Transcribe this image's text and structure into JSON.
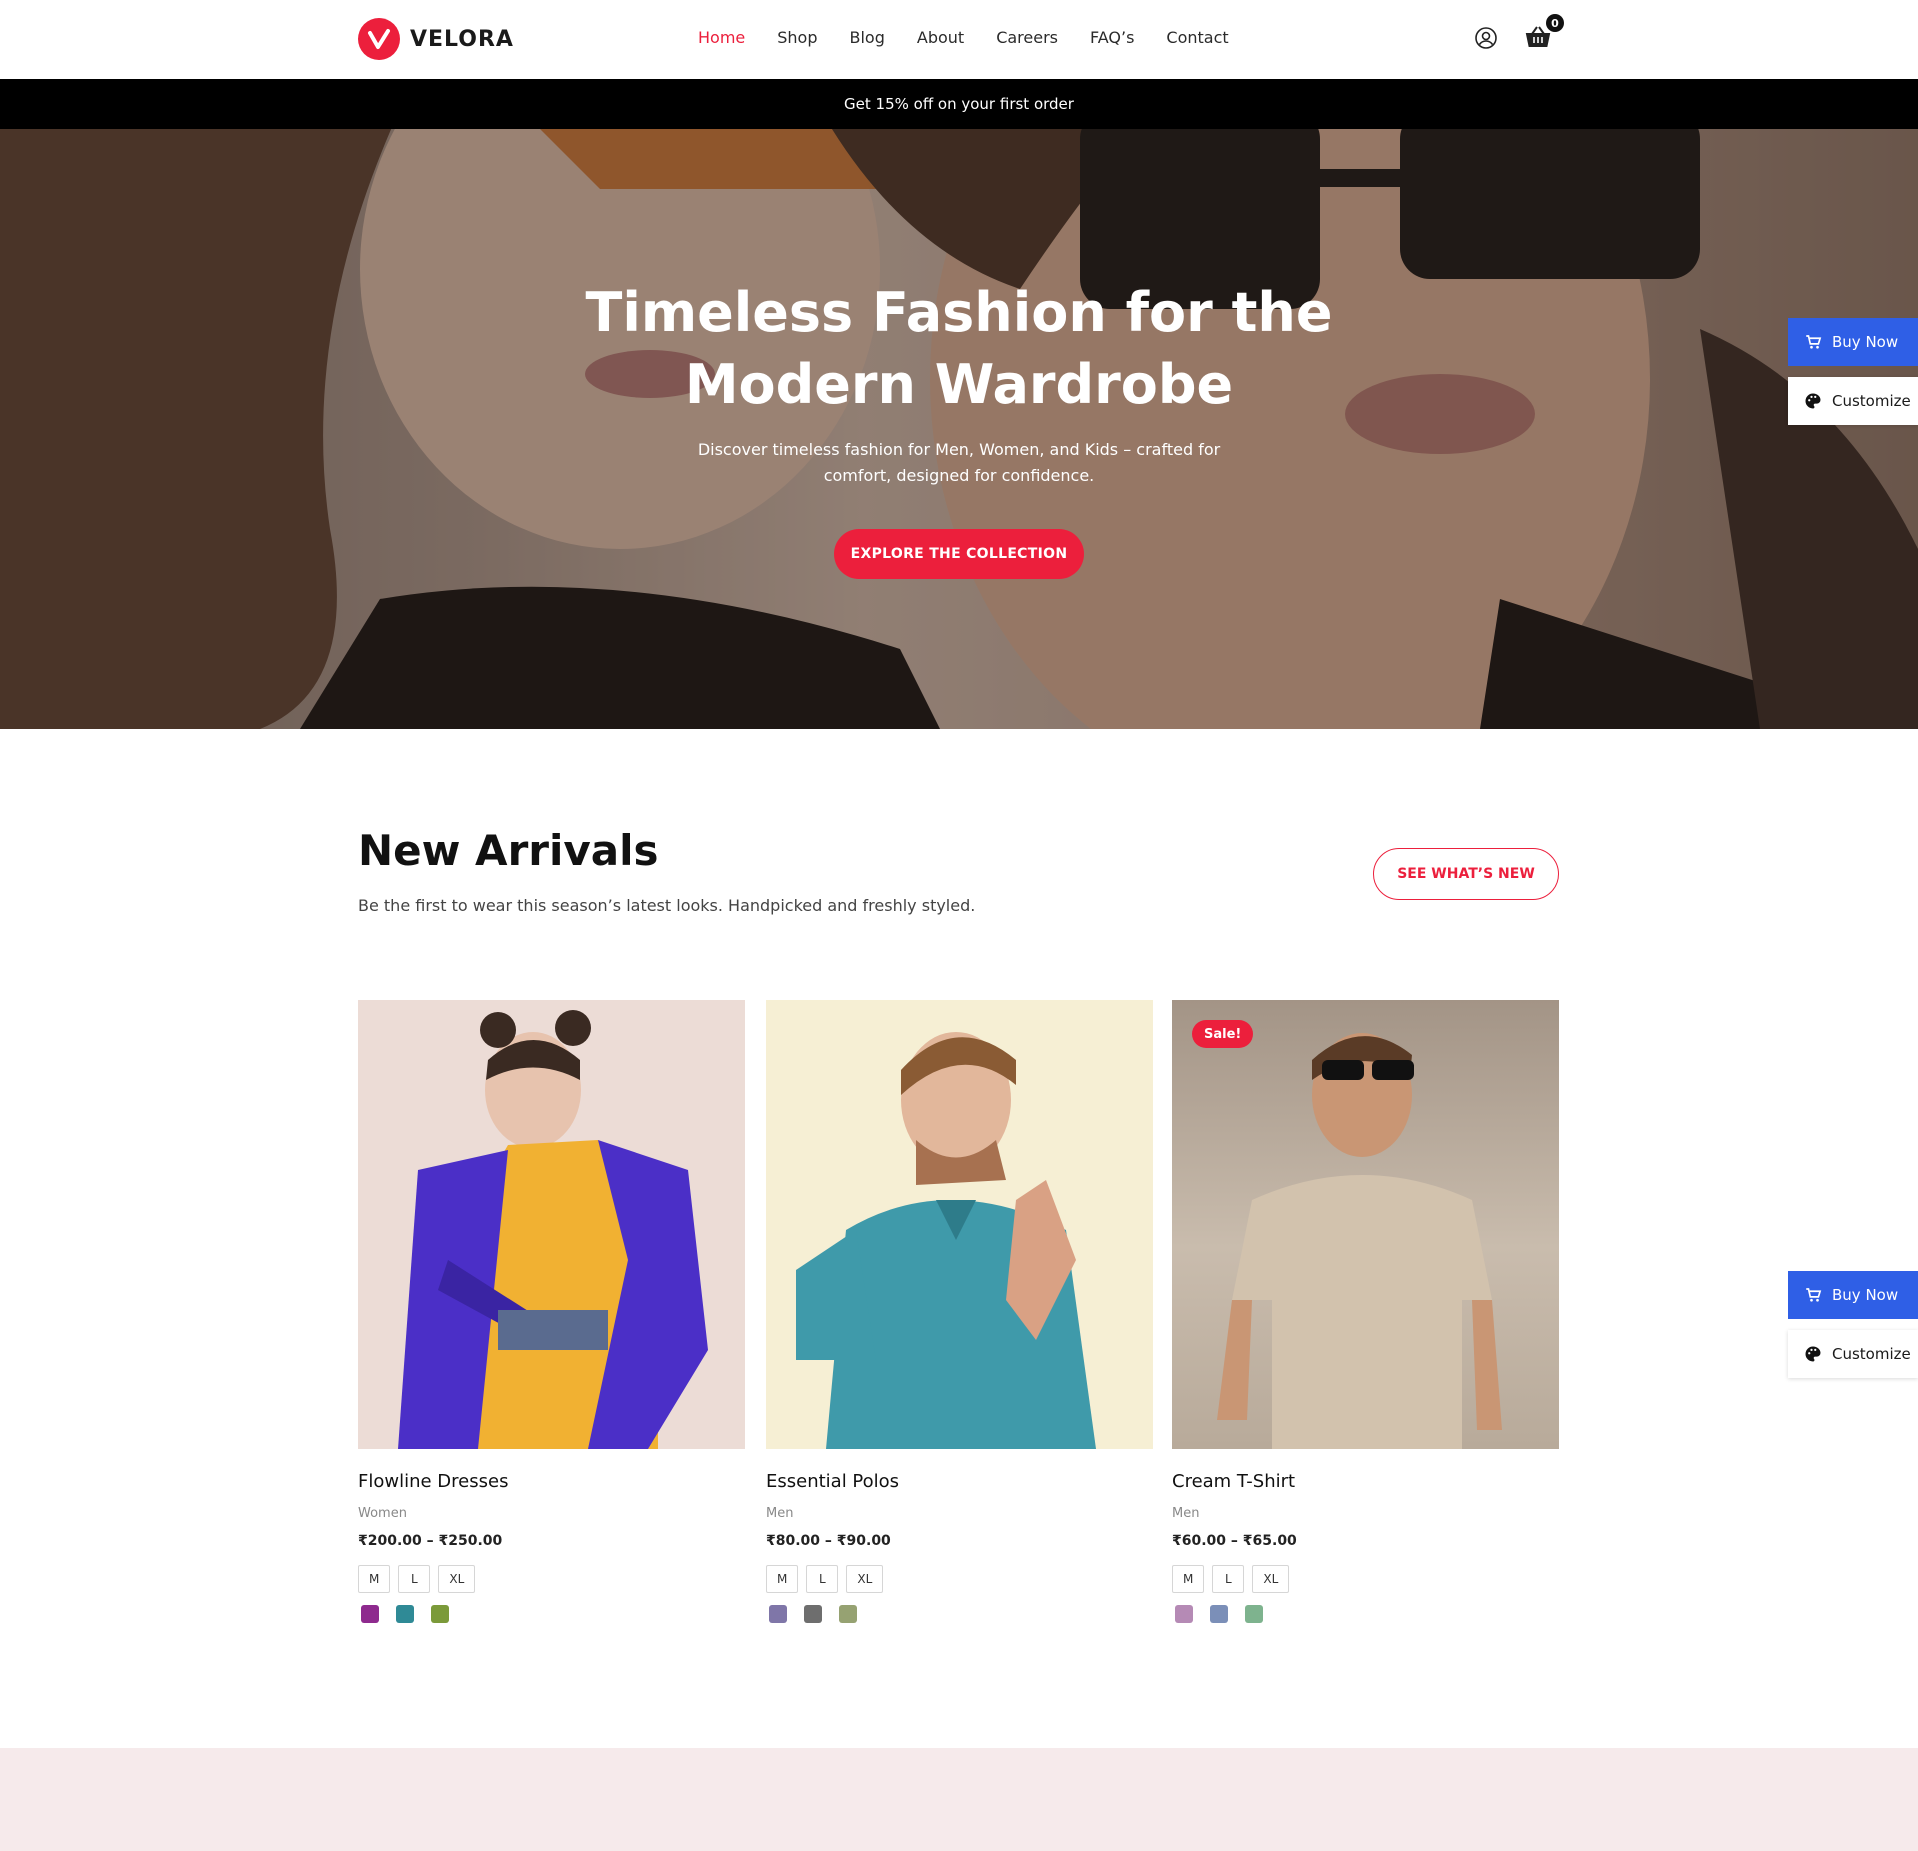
{
  "brand": {
    "name": "VELORA",
    "accent": "#ec1f3c"
  },
  "nav": [
    {
      "label": "Home"
    },
    {
      "label": "Shop"
    },
    {
      "label": "Blog"
    },
    {
      "label": "About"
    },
    {
      "label": "Careers"
    },
    {
      "label": "FAQ’s"
    },
    {
      "label": "Contact"
    }
  ],
  "header": {
    "user_icon": "user-circle-icon",
    "cart_icon": "basket-icon",
    "cart_count": "0"
  },
  "promo": {
    "text": "Get 15% off on your first order"
  },
  "hero": {
    "title_line1": "Timeless Fashion for the",
    "title_line2": "Modern Wardrobe",
    "subtitle_line1": "Discover timeless fashion for Men, Women, and Kids – crafted for",
    "subtitle_line2": "comfort, designed for confidence.",
    "cta": "EXPLORE THE COLLECTION"
  },
  "side_buttons": {
    "buy_now": "Buy Now",
    "customize": "Customize",
    "buy_color": "#2f5fe6"
  },
  "new_arrivals": {
    "title": "New Arrivals",
    "subtitle": "Be the first to wear this season’s latest looks. Handpicked and freshly styled.",
    "button": "SEE WHAT’S NEW"
  },
  "products": [
    {
      "name": "Flowline Dresses",
      "category": "Women",
      "price": "₹200.00 – ₹250.00",
      "sale": "",
      "sizes": [
        "M",
        "L",
        "XL"
      ],
      "colors": [
        "#8e2a8e",
        "#2f8a96",
        "#7b9a3a"
      ]
    },
    {
      "name": "Essential Polos",
      "category": "Men",
      "price": "₹80.00 – ₹90.00",
      "sale": "",
      "sizes": [
        "M",
        "L",
        "XL"
      ],
      "colors": [
        "#7f76a8",
        "#6e6e6e",
        "#96a272"
      ]
    },
    {
      "name": "Cream T-Shirt",
      "category": "Men",
      "price": "₹60.00 – ₹65.00",
      "sale": "Sale!",
      "sizes": [
        "M",
        "L",
        "XL"
      ],
      "colors": [
        "#b58ab5",
        "#7b8fb8",
        "#7eb38e"
      ]
    }
  ]
}
